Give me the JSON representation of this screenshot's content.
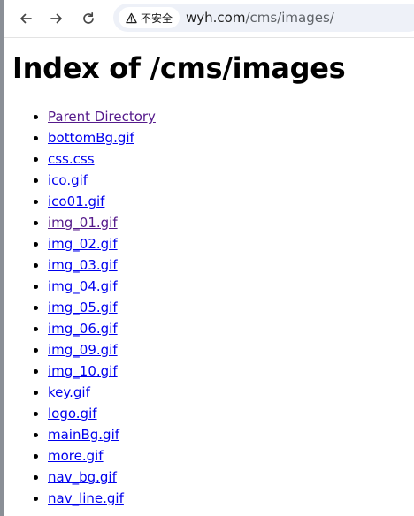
{
  "browser": {
    "security_label": "不安全",
    "url_host": "wyh.com",
    "url_path": "/cms/images/"
  },
  "page": {
    "title": "Index of /cms/images",
    "entries": [
      {
        "label": "Parent Directory",
        "visited": true
      },
      {
        "label": "bottomBg.gif",
        "visited": false
      },
      {
        "label": "css.css",
        "visited": false
      },
      {
        "label": "ico.gif",
        "visited": false
      },
      {
        "label": "ico01.gif",
        "visited": false
      },
      {
        "label": "img_01.gif",
        "visited": true
      },
      {
        "label": "img_02.gif",
        "visited": false
      },
      {
        "label": "img_03.gif",
        "visited": false
      },
      {
        "label": "img_04.gif",
        "visited": false
      },
      {
        "label": "img_05.gif",
        "visited": false
      },
      {
        "label": "img_06.gif",
        "visited": false
      },
      {
        "label": "img_09.gif",
        "visited": false
      },
      {
        "label": "img_10.gif",
        "visited": false
      },
      {
        "label": "key.gif",
        "visited": false
      },
      {
        "label": "logo.gif",
        "visited": false
      },
      {
        "label": "mainBg.gif",
        "visited": false
      },
      {
        "label": "more.gif",
        "visited": false
      },
      {
        "label": "nav_bg.gif",
        "visited": false
      },
      {
        "label": "nav_line.gif",
        "visited": false
      }
    ]
  },
  "colors": {
    "link": "#0000ee",
    "visited_link": "#551a8b",
    "omnibox_bg": "#eef1f8"
  },
  "icons": [
    "back-arrow-icon",
    "forward-arrow-icon",
    "reload-icon",
    "warning-triangle-icon"
  ]
}
